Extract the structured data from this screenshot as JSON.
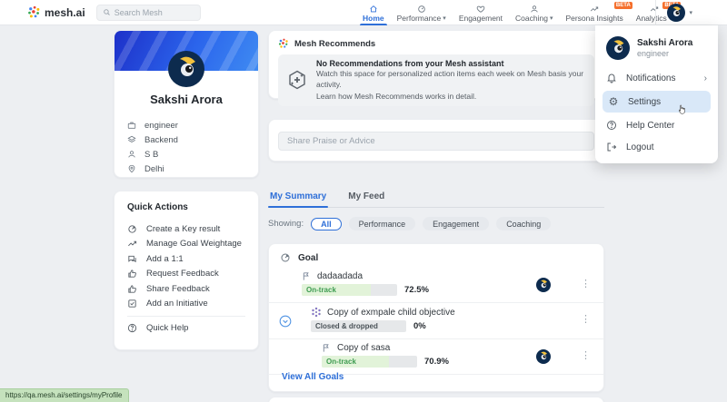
{
  "navbar": {
    "brand": "mesh.ai",
    "search_placeholder": "Search Mesh",
    "items": [
      {
        "label": "Home"
      },
      {
        "label": "Performance"
      },
      {
        "label": "Engagement"
      },
      {
        "label": "Coaching"
      },
      {
        "label": "Persona Insights",
        "badge": "BETA"
      },
      {
        "label": "Analytics",
        "badge": "BETA"
      }
    ]
  },
  "icons": {
    "chevron_down": "▾",
    "chevron_right": "›",
    "dots_menu": "⋮",
    "gear": "⚙"
  },
  "profile": {
    "name": "Sakshi Arora",
    "details": [
      {
        "icon": "briefcase-icon",
        "label": "engineer"
      },
      {
        "icon": "layers-icon",
        "label": "Backend"
      },
      {
        "icon": "person-icon",
        "label": "S B"
      },
      {
        "icon": "location-icon",
        "label": "Delhi"
      }
    ]
  },
  "quick_actions": {
    "title": "Quick Actions",
    "items": [
      {
        "icon": "key-result-icon",
        "label": "Create a Key result"
      },
      {
        "icon": "trend-icon",
        "label": "Manage Goal Weightage"
      },
      {
        "icon": "chat-icon",
        "label": "Add a 1:1"
      },
      {
        "icon": "thumb-icon",
        "label": "Request Feedback"
      },
      {
        "icon": "thumb-icon",
        "label": "Share Feedback"
      },
      {
        "icon": "check-square-icon",
        "label": "Add an Initiative"
      }
    ],
    "help": "Quick Help"
  },
  "recommends": {
    "title": "Mesh Recommends",
    "heading": "No Recommendations from your Mesh assistant",
    "body1": "Watch this space for personalized action items each week on Mesh basis your activity.",
    "body2": "Learn how Mesh Recommends works in detail."
  },
  "praise": {
    "placeholder": "Share Praise or Advice"
  },
  "tabs": {
    "summary": "My Summary",
    "feed": "My Feed"
  },
  "filters": {
    "label": "Showing:",
    "options": [
      "All",
      "Performance",
      "Engagement",
      "Coaching"
    ],
    "active": "All"
  },
  "goals": {
    "header": "Goal",
    "items": [
      {
        "title": "dadaadada",
        "status": "On-track",
        "value": "72.5%",
        "progress": 72.5
      },
      {
        "title": "Copy of exmpale child objective",
        "status": "Closed & dropped",
        "value": "0%",
        "progress": 0
      },
      {
        "title": "Copy of sasa",
        "status": "On-track",
        "value": "70.9%",
        "progress": 70.9
      }
    ],
    "view_all": "View All Goals"
  },
  "menu": {
    "name": "Sakshi Arora",
    "role": "engineer",
    "items": [
      "Notifications",
      "Settings",
      "Help Center",
      "Logout"
    ]
  },
  "statusbar": {
    "url": "https://qa.mesh.ai/settings/myProfile"
  },
  "colors": {
    "accent": "#2e6fd8",
    "beta_badge": "#f5702d",
    "on_track_text": "#3d9b50",
    "on_track_fill": "#e2f3d9",
    "menu_highlight": "#d9e8f8",
    "statusbar_bg": "#c5e2bd"
  }
}
